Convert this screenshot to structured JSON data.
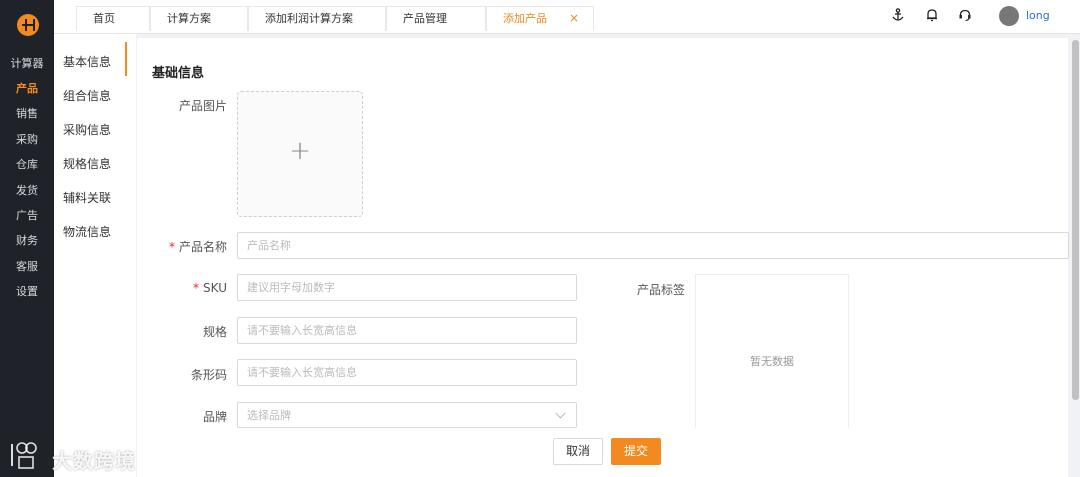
{
  "nav": {
    "items": [
      {
        "label": "计算器",
        "active": false
      },
      {
        "label": "产品",
        "active": true
      },
      {
        "label": "销售",
        "active": false
      },
      {
        "label": "采购",
        "active": false
      },
      {
        "label": "仓库",
        "active": false
      },
      {
        "label": "发货",
        "active": false
      },
      {
        "label": "广告",
        "active": false
      },
      {
        "label": "财务",
        "active": false
      },
      {
        "label": "客服",
        "active": false
      },
      {
        "label": "设置",
        "active": false
      }
    ]
  },
  "tabs": [
    {
      "label": "首页",
      "active": false
    },
    {
      "label": "计算方案",
      "active": false
    },
    {
      "label": "添加利润计算方案",
      "active": false
    },
    {
      "label": "产品管理",
      "active": false
    },
    {
      "label": "添加产品",
      "active": true,
      "close": "×"
    }
  ],
  "header": {
    "icons": [
      "anchor-icon",
      "bell-icon",
      "headset-icon"
    ],
    "username": "long"
  },
  "sidemenu": {
    "items": [
      "基本信息",
      "组合信息",
      "采购信息",
      "规格信息",
      "辅料关联",
      "物流信息"
    ],
    "active_index": 0
  },
  "form": {
    "section_title": "基础信息",
    "image_label": "产品图片",
    "upload_plus": "+",
    "name": {
      "label": "产品名称",
      "required_mark": "*",
      "placeholder": "产品名称"
    },
    "sku": {
      "label": "SKU",
      "required_mark": "*",
      "placeholder": "建议用字母加数字"
    },
    "spec": {
      "label": "规格",
      "placeholder": "请不要输入长宽高信息"
    },
    "barcode": {
      "label": "条形码",
      "placeholder": "请不要输入长宽高信息"
    },
    "brand": {
      "label": "品牌",
      "placeholder": "选择品牌"
    },
    "tags": {
      "label": "产品标签",
      "empty_text": "暂无数据"
    }
  },
  "footer": {
    "cancel": "取消",
    "submit": "提交"
  },
  "watermark": {
    "text": "大数跨境"
  },
  "colors": {
    "accent": "#f28a1f",
    "nav_bg": "#1f2228",
    "required": "#f5222d",
    "link": "#2b6fd6"
  }
}
